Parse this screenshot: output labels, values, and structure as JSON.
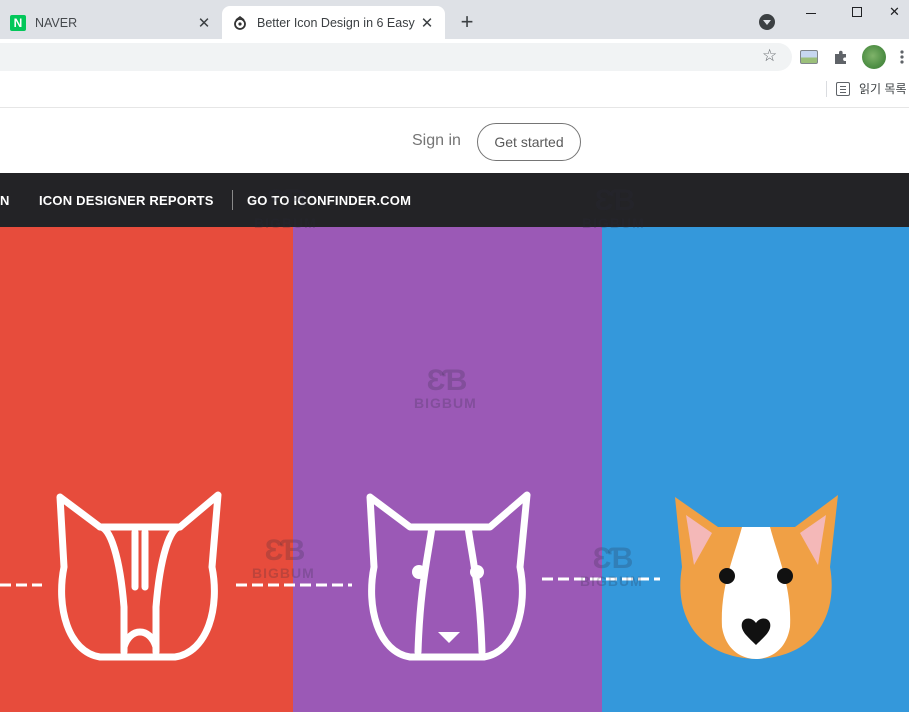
{
  "browser": {
    "tabs": [
      {
        "title": "NAVER",
        "favicon_letter": "N",
        "favicon_color": "#03c75a",
        "active": false
      },
      {
        "title": "Better Icon Design in 6 Easy",
        "active": true
      }
    ],
    "new_tab_symbol": "+",
    "close_symbol": "✕",
    "toolbar": {
      "bookmark_star": "☆",
      "extensions_icon": "puzzle-icon",
      "menu_symbol": "⋮"
    },
    "bookmarks_bar": {
      "reading_list_label": "읽기 목록"
    }
  },
  "header": {
    "sign_in_label": "Sign in",
    "get_started_label": "Get started"
  },
  "nav": {
    "partial_item": "N",
    "items": [
      "ICON DESIGNER REPORTS",
      "GO TO ICONFINDER.COM"
    ]
  },
  "hero": {
    "colors": {
      "red": "#e74c3c",
      "purple": "#9b59b6",
      "blue": "#3498db",
      "dog_orange": "#f0a045"
    },
    "watermark_text": "BIGBUM",
    "watermark_logo": "ƐƁ"
  }
}
